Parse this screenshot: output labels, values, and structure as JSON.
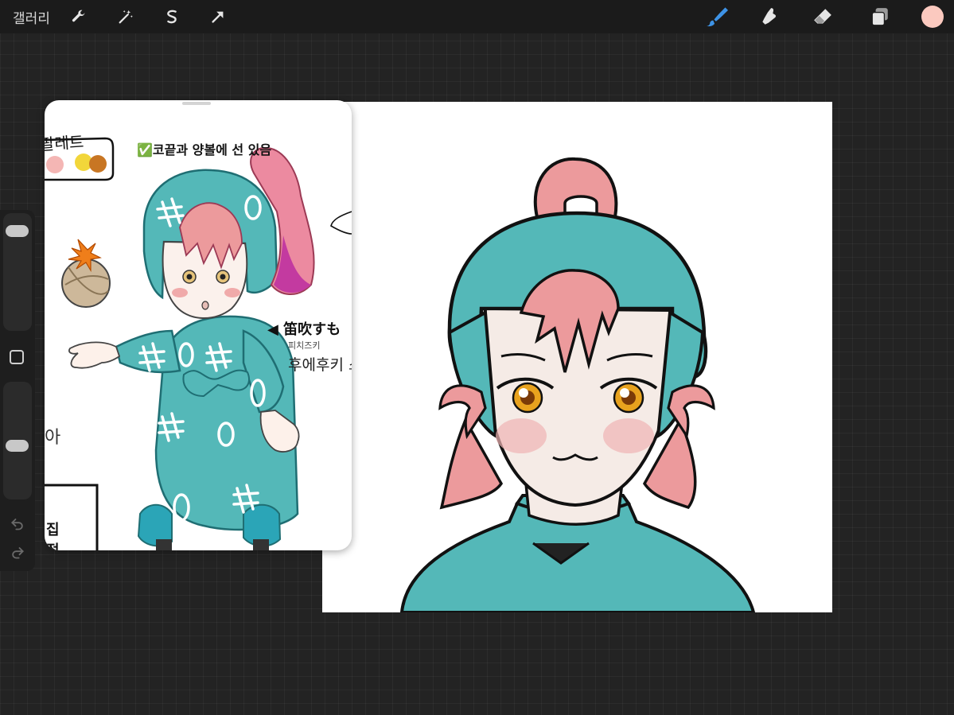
{
  "app": {
    "gallery_label": "갤러리"
  },
  "toolbar": {
    "left_tools": [
      {
        "name": "wrench-icon"
      },
      {
        "name": "magic-wand-icon"
      },
      {
        "name": "selection-icon"
      },
      {
        "name": "transform-arrow-icon"
      }
    ],
    "right_tools": [
      {
        "name": "brush-icon",
        "active": true
      },
      {
        "name": "smudge-icon"
      },
      {
        "name": "eraser-icon"
      },
      {
        "name": "layers-icon"
      }
    ],
    "current_color": "#fbc9bf",
    "active_color": "#3e93e6",
    "icon_color": "#e6e6e6"
  },
  "sidebar": {
    "size_slider_value": 0.08,
    "opacity_slider_value": 0.55,
    "undo_icon": "undo-icon",
    "redo_icon": "redo-icon"
  },
  "reference": {
    "palette_label": "팔레트",
    "note_title": "✅코끝과 양볼에 선 있음",
    "name_label": "◀ 笛吹すも",
    "reading_small": "피치즈키",
    "reading_large": "후에후키 스",
    "side_char": "아",
    "bottom_char1": "집",
    "bottom_char2": "정",
    "palette_colors": [
      "#f4b6b4",
      "#f2d63a",
      "#c87623"
    ]
  },
  "colors": {
    "teal": "#54b8b8",
    "hair_pink": "#ec9a9c",
    "skin": "#f5ebe6",
    "eye_gold": "#e8a21e"
  }
}
